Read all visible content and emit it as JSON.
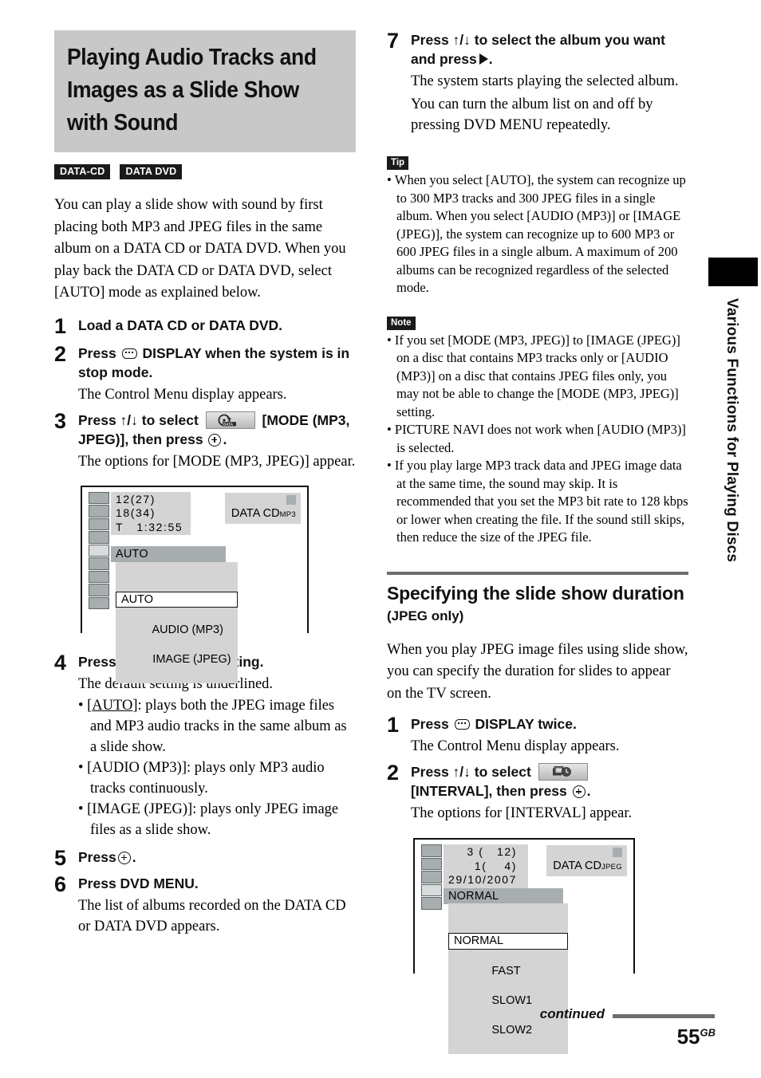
{
  "main_title": "Playing Audio Tracks and Images as a Slide Show with Sound",
  "badges": [
    {
      "label": "DATA-CD"
    },
    {
      "label": "DATA DVD"
    }
  ],
  "intro": "You can play a slide show with sound by first placing both MP3 and JPEG files in the same album on a DATA CD or DATA DVD. When you play back the DATA CD or DATA DVD, select [AUTO] mode as explained below.",
  "steps_left": [
    {
      "num": "1",
      "head_pre": "Load a DATA CD or DATA DVD.",
      "head_mid": "",
      "head_post": "",
      "note": ""
    },
    {
      "num": "2",
      "head_pre": "Press",
      "head_mid": "DISPLAY when the system is in stop mode.",
      "head_post": "",
      "note": "The Control Menu display appears."
    },
    {
      "num": "3",
      "head_pre": "Press ↑/↓ to select",
      "head_mid": "[MODE (MP3, JPEG)], then press",
      "head_post": ".",
      "note": "The options for [MODE (MP3, JPEG)] appear."
    },
    {
      "num": "4",
      "head_pre": "Press ↑/↓ to select a setting.",
      "head_mid": "",
      "head_post": "",
      "note": "The default setting is underlined."
    },
    {
      "num": "5",
      "head_pre": "Press",
      "head_mid": "",
      "head_post": ".",
      "note": ""
    },
    {
      "num": "6",
      "head_pre": "Press DVD MENU.",
      "head_mid": "",
      "head_post": "",
      "note": "The list of albums recorded on the DATA CD or DATA DVD appears."
    }
  ],
  "step4_bullets": [
    {
      "key": "AUTO",
      "rest": ": plays both the JPEG image files and MP3 audio tracks in the same album as a slide show."
    },
    {
      "key": "AUDIO (MP3)",
      "rest": ": plays only MP3 audio tracks continuously."
    },
    {
      "key": "IMAGE (JPEG)",
      "rest": ": plays only JPEG image files as a slide show."
    }
  ],
  "tv_mode": {
    "info_lines": [
      "12(27)",
      "18(34)",
      "T   1:32:55"
    ],
    "current": "AUTO",
    "options": [
      "AUTO",
      "AUDIO (MP3)",
      "IMAGE (JPEG)"
    ],
    "disc_label": "DATA CD",
    "disc_format": "MP3",
    "rail_count": 9,
    "rail_selected_index": 4
  },
  "tv_interval": {
    "info_lines": [
      "3 (   12)",
      "1(    4)",
      "29/10/2007"
    ],
    "current": "NORMAL",
    "options": [
      "NORMAL",
      "FAST",
      "SLOW1",
      "SLOW2"
    ],
    "disc_label": "DATA CD",
    "disc_format": "JPEG",
    "rail_count": 5,
    "rail_selected_index": 3
  },
  "step7": {
    "num": "7",
    "head_pre": "Press ↑/↓ to select the album you want and press",
    "head_post": ".",
    "note1": "The system starts playing the selected album.",
    "note2": "You can turn the album list on and off by pressing DVD MENU repeatedly."
  },
  "tip": {
    "tag": "Tip",
    "items": [
      "When you select [AUTO], the system can recognize up to 300 MP3 tracks and 300 JPEG files in a single album. When you select [AUDIO (MP3)] or [IMAGE (JPEG)], the system can recognize up to 600 MP3 or 600 JPEG files in a single album. A maximum of 200 albums can be recognized regardless of the selected mode."
    ]
  },
  "note": {
    "tag": "Note",
    "items": [
      "If you set [MODE (MP3, JPEG)] to [IMAGE (JPEG)] on a disc that contains MP3 tracks only or [AUDIO (MP3)] on a disc that contains JPEG files only, you may not be able to change the [MODE (MP3, JPEG)] setting.",
      "PICTURE NAVI does not work when [AUDIO (MP3)] is selected.",
      "If you play large MP3 track data and JPEG image data at the same time, the sound may skip. It is recommended that you set the MP3 bit rate to 128 kbps or lower when creating the file. If the sound still skips, then reduce the size of the JPEG file."
    ]
  },
  "section": {
    "title": "Specifying the slide show duration",
    "subtitle": "(JPEG only)",
    "intro": "When you play JPEG image files using slide show, you can specify the duration for slides to appear on the TV screen.",
    "steps": [
      {
        "num": "1",
        "head_pre": "Press",
        "head_mid": "DISPLAY twice.",
        "head_post": "",
        "note": "The Control Menu display appears."
      },
      {
        "num": "2",
        "head_pre": "Press ↑/↓ to select",
        "head_mid": "[INTERVAL], then press",
        "head_post": ".",
        "note": "The options for [INTERVAL] appear."
      }
    ]
  },
  "edge_tab_text": "Various Functions for Playing Discs",
  "footer": {
    "continued": "continued",
    "page_number": "55",
    "page_suffix": "GB"
  },
  "colors": {
    "banner_bg": "#c8c8c8",
    "badge_bg": "#1a1a1a",
    "rule": "#6d6d6d",
    "screen_panel": "#d4d4d4",
    "screen_highlight": "#a8aeb0"
  }
}
